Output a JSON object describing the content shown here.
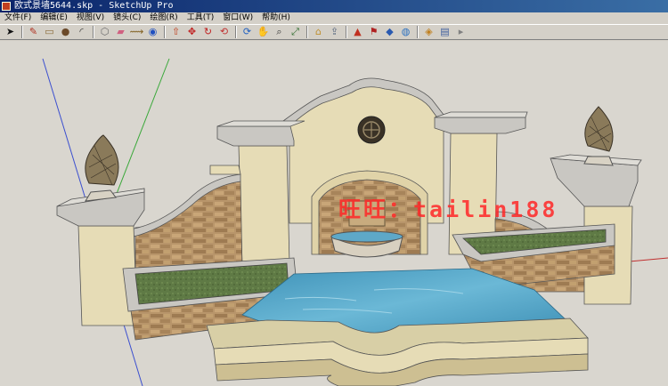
{
  "window": {
    "title": "欧式景墙5644.skp - SketchUp Pro"
  },
  "menu": {
    "items": [
      {
        "label": "文件(F)"
      },
      {
        "label": "编辑(E)"
      },
      {
        "label": "视图(V)"
      },
      {
        "label": "镜头(C)"
      },
      {
        "label": "绘图(R)"
      },
      {
        "label": "工具(T)"
      },
      {
        "label": "窗口(W)"
      },
      {
        "label": "帮助(H)"
      }
    ]
  },
  "toolbar": {
    "tools": [
      {
        "name": "select-tool-icon",
        "glyph": "➤"
      },
      {
        "name": "pencil-tool-icon",
        "glyph": "✎"
      },
      {
        "name": "rectangle-tool-icon",
        "glyph": "▭"
      },
      {
        "name": "circle-tool-icon",
        "glyph": "●"
      },
      {
        "name": "arc-tool-icon",
        "glyph": "◜"
      },
      {
        "name": "make-component-icon",
        "glyph": "⬡"
      },
      {
        "name": "eraser-tool-icon",
        "glyph": "▰"
      },
      {
        "name": "tape-measure-icon",
        "glyph": "⟿"
      },
      {
        "name": "paint-bucket-icon",
        "glyph": "◉"
      },
      {
        "name": "push-pull-icon",
        "glyph": "⇧"
      },
      {
        "name": "move-tool-icon",
        "glyph": "✥"
      },
      {
        "name": "rotate-tool-icon",
        "glyph": "↻"
      },
      {
        "name": "offset-tool-icon",
        "glyph": "⟲"
      },
      {
        "name": "orbit-tool-icon",
        "glyph": "⟳"
      },
      {
        "name": "pan-tool-icon",
        "glyph": "✋"
      },
      {
        "name": "zoom-tool-icon",
        "glyph": "⌕"
      },
      {
        "name": "zoom-extents-icon",
        "glyph": "⤢"
      },
      {
        "name": "warehouse-icon",
        "glyph": "⌂"
      },
      {
        "name": "share-model-icon",
        "glyph": "⇪"
      },
      {
        "name": "component-icon",
        "glyph": "▲"
      },
      {
        "name": "extension-icon",
        "glyph": "⚑"
      },
      {
        "name": "ruby-icon",
        "glyph": "◆"
      },
      {
        "name": "earth-icon",
        "glyph": "◍"
      },
      {
        "name": "styles-icon",
        "glyph": "◈"
      },
      {
        "name": "layout-icon",
        "glyph": "▤"
      },
      {
        "name": "send-icon",
        "glyph": "▸"
      }
    ]
  },
  "viewport": {
    "watermark": "旺旺：tailin188",
    "colors": {
      "background": "#d9d6cf",
      "stucco": "#e6dcb6",
      "cap": "#c9c7c2",
      "stone": "#b8956a",
      "water": "#4fa3c6",
      "grass": "#5f7a45"
    }
  }
}
